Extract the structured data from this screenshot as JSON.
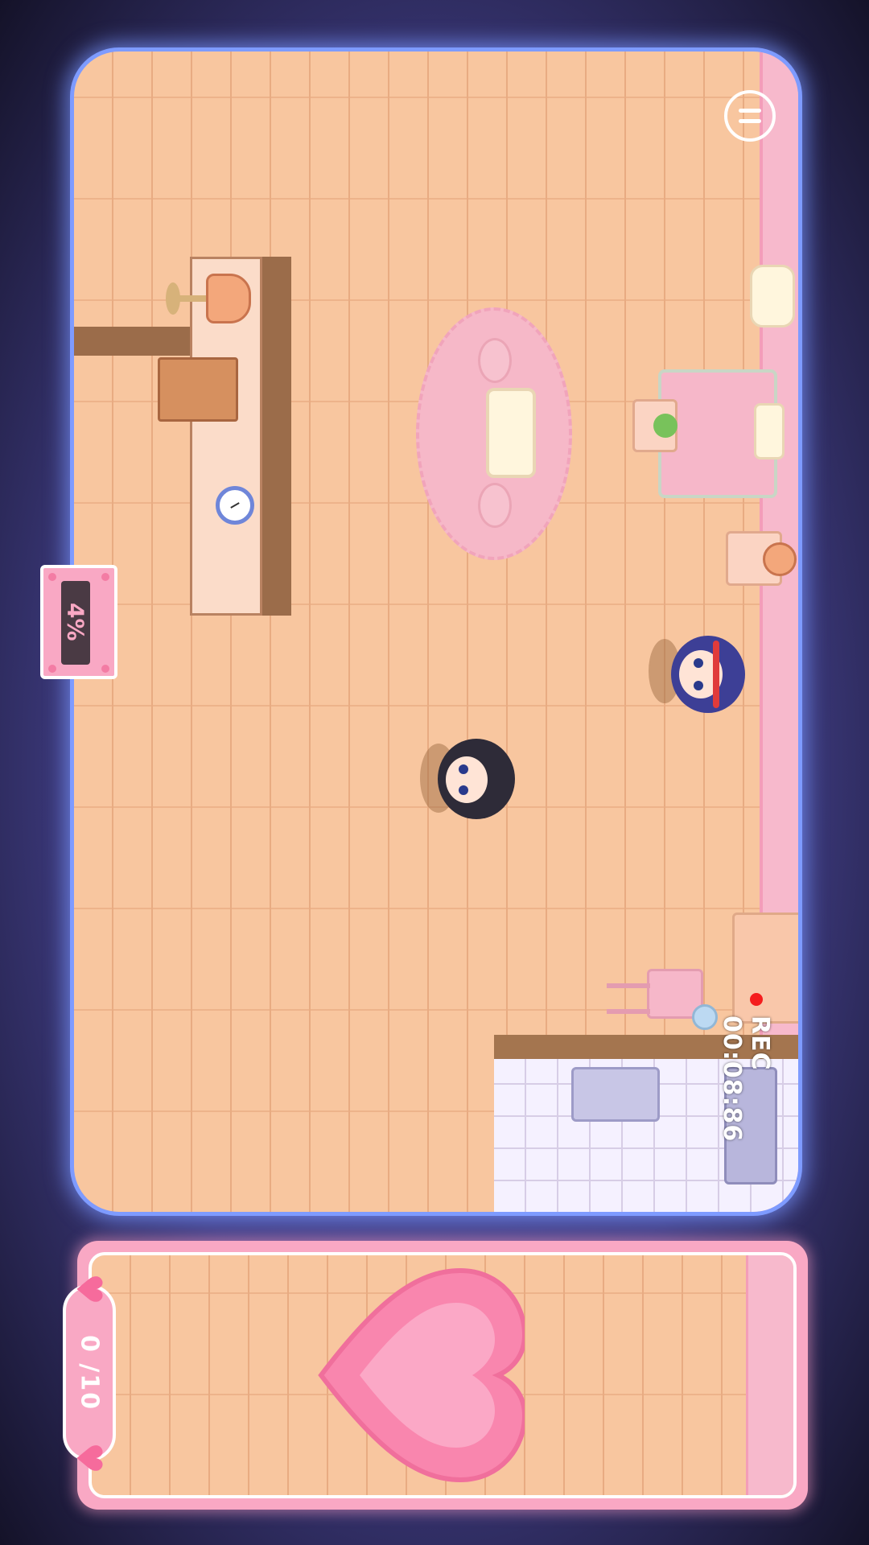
{
  "hud": {
    "progress": {
      "percent_text": "4%",
      "value": 0.04
    },
    "score": {
      "text": "0 /10",
      "current": 0,
      "goal": 10
    },
    "pause_icon": "pause-icon",
    "recording": {
      "label": "REC",
      "time": "00:08:86"
    }
  },
  "colors": {
    "frame_glow": "#7e9bff",
    "floor": "#f8c69f",
    "wall": "#f7b9cc",
    "panel": "#f9a8c4",
    "heart": "#f986ae",
    "rec_dot": "#f51d1d"
  },
  "scene": {
    "characters": [
      "boy-character",
      "girl-character"
    ],
    "furniture": [
      "shelf",
      "cardboard-box",
      "desk-lamp",
      "wall-clock",
      "rug",
      "coffee-table",
      "stools",
      "bed",
      "nightstand",
      "potted-plant",
      "cabinet",
      "chair",
      "kitchen",
      "sink"
    ],
    "icons": [
      "pause-icon",
      "heart-icon",
      "clock-icon"
    ]
  }
}
